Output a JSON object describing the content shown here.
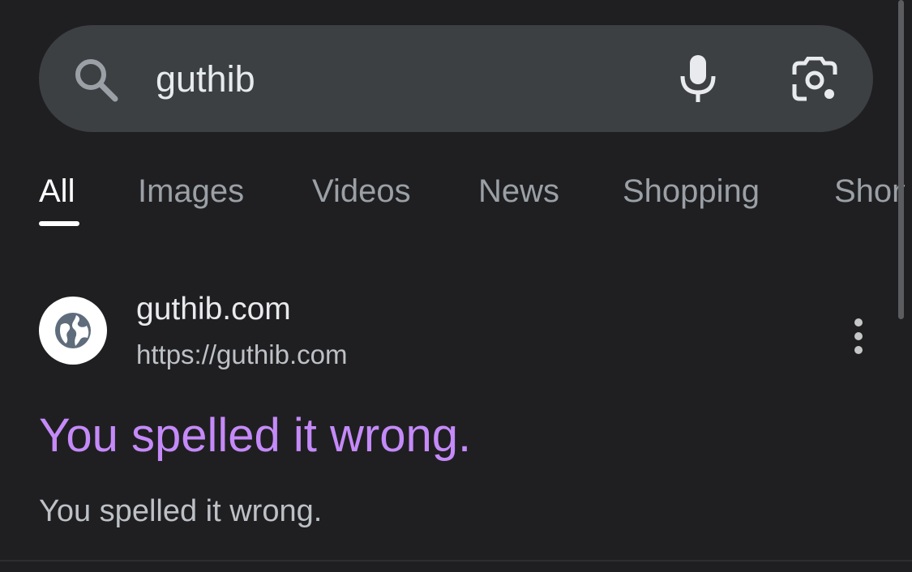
{
  "search": {
    "query": "guthib",
    "icons": {
      "search": "search-icon",
      "voice": "mic-icon",
      "lens": "camera-lens-icon"
    }
  },
  "tabs": [
    {
      "label": "All",
      "active": true
    },
    {
      "label": "Images",
      "active": false
    },
    {
      "label": "Videos",
      "active": false
    },
    {
      "label": "News",
      "active": false
    },
    {
      "label": "Shopping",
      "active": false
    },
    {
      "label": "Short videos",
      "active": false
    }
  ],
  "result": {
    "favicon": "globe-icon",
    "site_name": "guthib.com",
    "url": "https://guthib.com",
    "title": "You spelled it wrong.",
    "snippet": "You spelled it wrong.",
    "menu_icon": "more-vertical-icon"
  },
  "colors": {
    "background": "#1f1f21",
    "search_bar": "#3c4043",
    "visited_link": "#c58af9",
    "active_tab": "#ffffff",
    "inactive_tab": "#9aa0a6"
  }
}
